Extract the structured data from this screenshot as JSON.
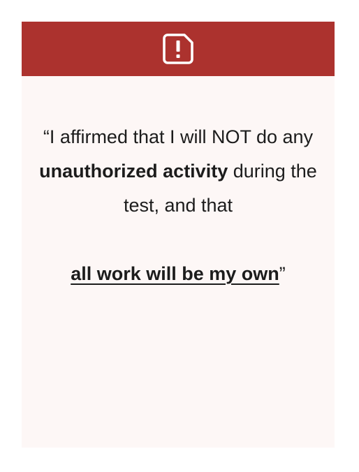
{
  "header": {
    "icon": "alert-square-icon",
    "background_color": "#ac322e"
  },
  "pledge": {
    "open_quote": "“",
    "part1": "I affirmed that I will NOT do any ",
    "bold1": "unauthorized activity",
    "part2": " during the test, and that",
    "underlined": "all work will be my own",
    "close_quote": "”"
  },
  "colors": {
    "card_background": "#fdf7f6",
    "text": "#1c1c1c"
  }
}
